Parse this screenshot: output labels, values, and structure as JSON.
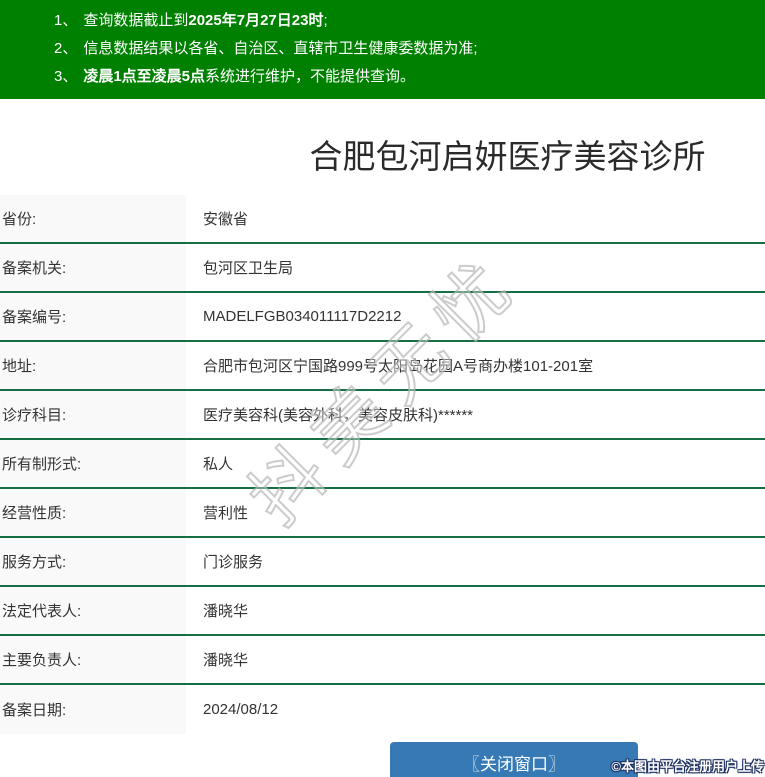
{
  "colors": {
    "header_green": "#008000",
    "divider_green": "#166e45",
    "button_blue": "#3679b5",
    "label_bg": "#f9f9f9",
    "text": "#333333"
  },
  "header": {
    "notices": [
      {
        "num": "1、",
        "segments": [
          {
            "text": "查询数据截止到",
            "bold": false
          },
          {
            "text": "2025年7月27日23时",
            "bold": true
          },
          {
            "text": ";",
            "bold": false
          }
        ]
      },
      {
        "num": "2、",
        "segments": [
          {
            "text": "信息数据结果以各省、自治区、直辖市卫生健康委数据为准;",
            "bold": false
          }
        ]
      },
      {
        "num": "3、",
        "segments": [
          {
            "text": "凌晨1点至凌晨5点",
            "bold": true
          },
          {
            "text": "系统进行维护，不能提供查询。",
            "bold": false
          }
        ]
      }
    ]
  },
  "title": "合肥包河启妍医疗美容诊所",
  "table": {
    "rows": [
      {
        "label": "省份:",
        "value": "安徽省"
      },
      {
        "label": "备案机关:",
        "value": "包河区卫生局"
      },
      {
        "label": "备案编号:",
        "value": "MADELFGB034011117D2212"
      },
      {
        "label": "地址:",
        "value": "合肥市包河区宁国路999号太阳岛花园A号商办楼101-201室"
      },
      {
        "label": "诊疗科目:",
        "value": "医疗美容科(美容外科，美容皮肤科)******"
      },
      {
        "label": "所有制形式:",
        "value": "私人"
      },
      {
        "label": "经营性质:",
        "value": "营利性"
      },
      {
        "label": "服务方式:",
        "value": "门诊服务"
      },
      {
        "label": "法定代表人:",
        "value": "潘晓华"
      },
      {
        "label": "主要负责人:",
        "value": "潘晓华"
      },
      {
        "label": "备案日期:",
        "value": "2024/08/12"
      }
    ]
  },
  "close_button": {
    "label": "〖关闭窗口〗"
  },
  "watermarks": {
    "diagonal": "抖美无忧",
    "credit": "©本图由平台注册用户上传"
  }
}
